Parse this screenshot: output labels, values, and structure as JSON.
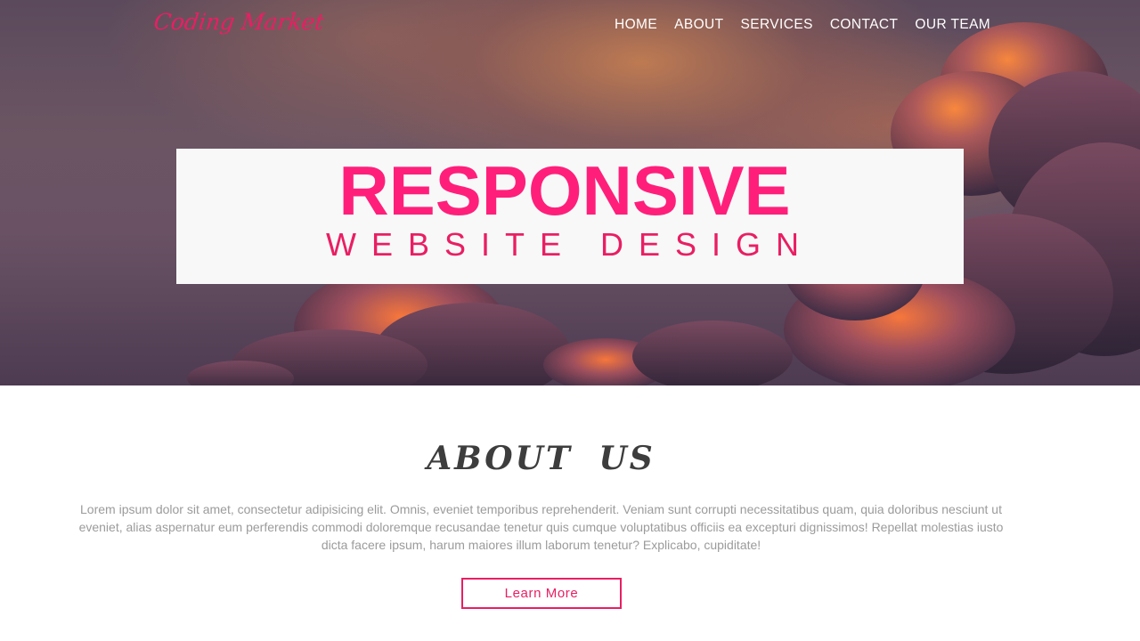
{
  "header": {
    "logo": "Coding Market",
    "nav": [
      "HOME",
      "ABOUT",
      "SERVICES",
      "CONTACT",
      "OUR TEAM"
    ]
  },
  "hero": {
    "title": "RESPONSIVE",
    "subtitle": "WEBSITE DESIGN"
  },
  "about": {
    "heading": "ABOUT US",
    "text": "Lorem ipsum dolor sit amet, consectetur adipisicing elit. Omnis, eveniet temporibus reprehenderit. Veniam sunt corrupti necessitatibus quam, quia doloribus nesciunt ut eveniet, alias aspernatur eum perferendis commodi doloremque recusandae tenetur quis cumque voluptatibus officiis ea excepturi dignissimos! Repellat molestias iusto dicta facere ipsum, harum maiores illum laborum tenetur? Explicabo, cupiditate!",
    "button": "Learn More"
  },
  "colors": {
    "accent": "#e91e63",
    "title_pink": "#ff1f7a",
    "heading": "#3d3d3d",
    "body_text": "#9b9b9b"
  }
}
